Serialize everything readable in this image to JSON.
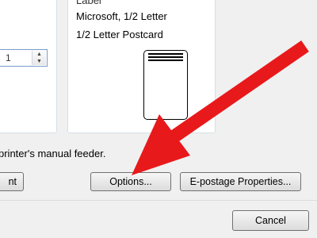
{
  "group_right": {
    "label": "Label",
    "lines": [
      "Microsoft, 1/2 Letter",
      "1/2 Letter Postcard"
    ]
  },
  "spinner": {
    "value": "1"
  },
  "feeder_text": "printer's manual feeder.",
  "buttons": {
    "left_partial": "nt",
    "options": "Options...",
    "epostage": "E-postage Properties...",
    "cancel": "Cancel"
  },
  "colors": {
    "annotation_arrow": "#e8191b",
    "dialog_bg": "#f0f0f0"
  },
  "icons": [
    "spin-up-icon",
    "spin-down-icon",
    "red-arrow-annotation"
  ]
}
